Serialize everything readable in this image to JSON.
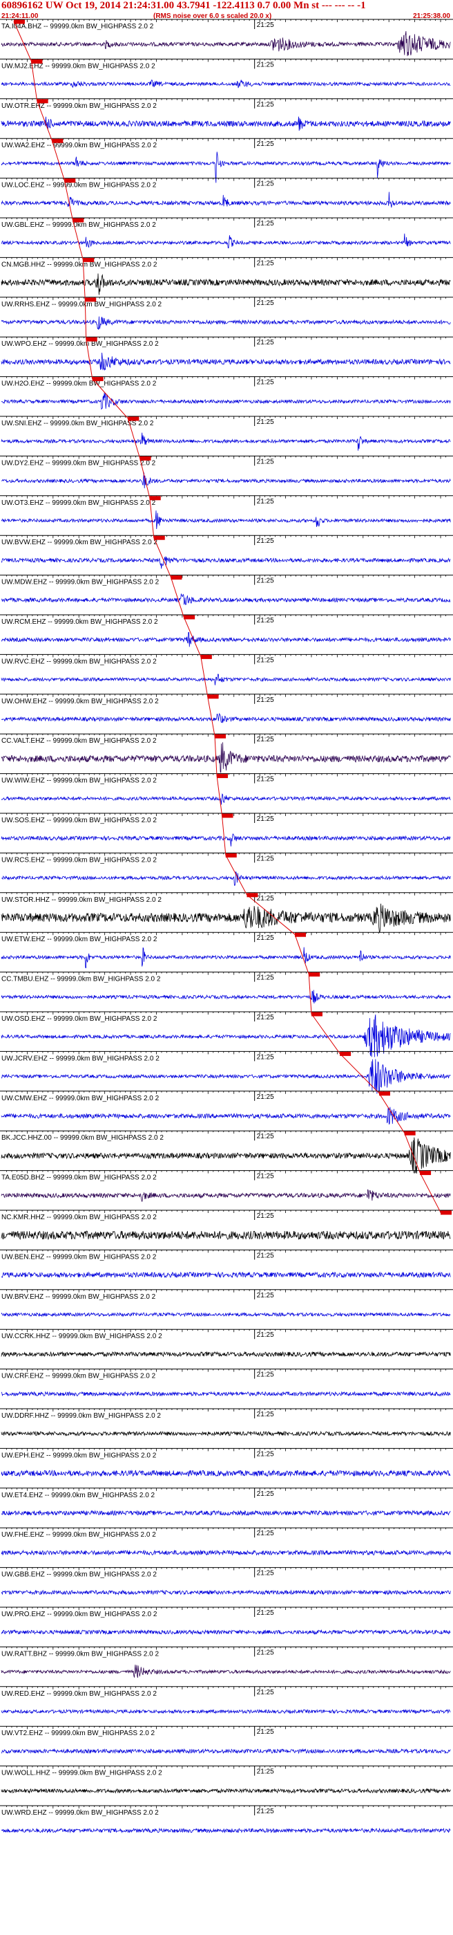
{
  "header": {
    "title": "60896162 UW Oct 19, 2014 21:24:31.00   43.7941 -122.4113  0.7 0.00 Mn st --- --- --  -1",
    "start_time": "21:24:11.00",
    "note": "(RMS noise over 6.0 s scaled 20.0 x)",
    "end_time": "21:25:38.00"
  },
  "chart_data": {
    "type": "line",
    "x_start": "21:24:11.00",
    "x_end": "21:25:38.00",
    "tick_label": "21:25",
    "colors": {
      "title": "#cc0000",
      "blue": "#0000dd",
      "black": "#000000",
      "purple": "#2a0050",
      "pick": "#dd0000"
    },
    "series": [
      {
        "name": "TA.I04A.BHZ -- 99999.0km BW_HIGHPASS  2.0  2",
        "color": "purple",
        "amp": 0.35,
        "bursts": [
          [
            20.1,
            1.6,
            0.55
          ],
          [
            53.0,
            6.0,
            1.4
          ],
          [
            78.0,
            9.0,
            2.4
          ]
        ],
        "pick": 2.4
      },
      {
        "name": "UW.MJ2.EHZ -- 99999.0km BW_HIGHPASS  2.0  2",
        "color": "blue",
        "amp": 0.3,
        "bursts": [
          [
            14,
            2,
            0.6
          ],
          [
            29,
            2,
            0.5
          ],
          [
            46,
            3,
            0.6
          ]
        ],
        "pick": 5.8
      },
      {
        "name": "UW.OTR.EHZ -- 99999.0km BW_HIGHPASS  2.0  2",
        "color": "blue",
        "amp": 0.5,
        "bursts": [
          [
            8.5,
            1.2,
            1.6
          ],
          [
            57.5,
            1.2,
            1.3
          ]
        ],
        "pick": 6.9
      },
      {
        "name": "UW.WA2.EHZ -- 99999.0km BW_HIGHPASS  2.0  2",
        "color": "blue",
        "amp": 0.3,
        "bursts": [
          [
            41.5,
            0.7,
            4.0
          ],
          [
            72.8,
            0.7,
            4.0
          ],
          [
            14.5,
            1.0,
            1.3
          ]
        ],
        "pick": 9.8
      },
      {
        "name": "UW.LOC.EHZ -- 99999.0km BW_HIGHPASS  2.0  2",
        "color": "blue",
        "amp": 0.35,
        "bursts": [
          [
            13,
            1.2,
            1.6
          ],
          [
            43,
            0.8,
            2.0
          ],
          [
            75,
            0.8,
            1.8
          ]
        ],
        "pick": 12.2
      },
      {
        "name": "UW.GBL.EHZ -- 99999.0km BW_HIGHPASS  2.0  2",
        "color": "blue",
        "amp": 0.3,
        "bursts": [
          [
            16.5,
            1.0,
            1.5
          ],
          [
            44,
            0.9,
            1.6
          ],
          [
            78,
            0.9,
            1.6
          ]
        ],
        "pick": 13.8
      },
      {
        "name": "CN.MGB.HHZ -- 99999.0km BW_HIGHPASS  2.0  2",
        "color": "black",
        "amp": 0.55,
        "bursts": [
          [
            18.5,
            1.5,
            3.0
          ]
        ],
        "pick": 15.8
      },
      {
        "name": "UW.RRHS.EHZ -- 99999.0km BW_HIGHPASS  2.0  2",
        "color": "blue",
        "amp": 0.35,
        "bursts": [
          [
            18.7,
            2.0,
            1.4
          ]
        ],
        "pick": 16.2
      },
      {
        "name": "UW.WPO.EHZ -- 99999.0km BW_HIGHPASS  2.0  2",
        "color": "blue",
        "amp": 0.45,
        "bursts": [
          [
            19.5,
            4.0,
            1.5
          ]
        ],
        "pick": 16.4
      },
      {
        "name": "UW.H2O.EHZ -- 99999.0km BW_HIGHPASS  2.0  2",
        "color": "blue",
        "amp": 0.3,
        "bursts": [
          [
            19.6,
            2.5,
            1.9
          ]
        ],
        "pick": 17.6
      },
      {
        "name": "UW.SNI.EHZ -- 99999.0km BW_HIGHPASS  2.0  2",
        "color": "blue",
        "amp": 0.3,
        "bursts": [
          [
            27,
            1.0,
            2.3
          ],
          [
            69,
            0.8,
            2.4
          ],
          [
            87,
            0.6,
            3.0
          ]
        ],
        "pick": 24.5
      },
      {
        "name": "UW.DY2.EHZ -- 99999.0km BW_HIGHPASS  2.0  2",
        "color": "blue",
        "amp": 0.3,
        "bursts": [
          [
            27.5,
            1.5,
            1.5
          ]
        ],
        "pick": 26.8
      },
      {
        "name": "UW.OT3.EHZ -- 99999.0km BW_HIGHPASS  2.0  2",
        "color": "blue",
        "amp": 0.3,
        "bursts": [
          [
            30,
            1.0,
            2.0
          ],
          [
            61,
            0.8,
            2.3
          ]
        ],
        "pick": 28.7
      },
      {
        "name": "UW.BVW.EHZ -- 99999.0km BW_HIGHPASS  2.0  2",
        "color": "blue",
        "amp": 0.35,
        "bursts": [
          [
            31,
            1.8,
            1.5
          ]
        ],
        "pick": 29.5
      },
      {
        "name": "UW.MDW.EHZ -- 99999.0km BW_HIGHPASS  2.0  2",
        "color": "blue",
        "amp": 0.35,
        "bursts": [
          [
            35,
            2.0,
            1.5
          ]
        ],
        "pick": 32.8
      },
      {
        "name": "UW.RCM.EHZ -- 99999.0km BW_HIGHPASS  2.0  2",
        "color": "blue",
        "amp": 0.35,
        "bursts": [
          [
            36,
            1.5,
            1.7
          ]
        ],
        "pick": 35.3
      },
      {
        "name": "UW.RVC.EHZ -- 99999.0km BW_HIGHPASS  2.0  2",
        "color": "blue",
        "amp": 0.3,
        "bursts": [
          [
            41.5,
            1.5,
            1.3
          ]
        ],
        "pick": 38.6
      },
      {
        "name": "UW.OHW.EHZ -- 99999.0km BW_HIGHPASS  2.0  2",
        "color": "blue",
        "amp": 0.35,
        "bursts": [
          [
            41.8,
            1.5,
            1.3
          ]
        ],
        "pick": 39.9
      },
      {
        "name": "CC.VALT.EHZ -- 99999.0km BW_HIGHPASS  2.0  2",
        "color": "purple",
        "amp": 0.6,
        "bursts": [
          [
            42.6,
            3.0,
            2.8
          ]
        ],
        "pick": 41.3
      },
      {
        "name": "UW.WIW.EHZ -- 99999.0km BW_HIGHPASS  2.0  2",
        "color": "blue",
        "amp": 0.3,
        "bursts": [
          [
            42.6,
            1.0,
            1.4
          ]
        ],
        "pick": 41.7
      },
      {
        "name": "UW.SOS.EHZ -- 99999.0km BW_HIGHPASS  2.0  2",
        "color": "blue",
        "amp": 0.35,
        "bursts": [
          [
            44.4,
            1.0,
            1.4
          ]
        ],
        "pick": 42.7
      },
      {
        "name": "UW.RCS.EHZ -- 99999.0km BW_HIGHPASS  2.0  2",
        "color": "blue",
        "amp": 0.3,
        "bursts": [
          [
            45.2,
            1.0,
            1.6
          ]
        ],
        "pick": 43.4
      },
      {
        "name": "UW.STOR.HHZ -- 99999.0km BW_HIGHPASS  2.0  2",
        "color": "black",
        "amp": 0.8,
        "bursts": [
          [
            48,
            10,
            1.9
          ],
          [
            73,
            8,
            1.9
          ]
        ],
        "pick": 47.5
      },
      {
        "name": "UW.ETW.EHZ -- 99999.0km BW_HIGHPASS  2.0  2",
        "color": "blue",
        "amp": 0.3,
        "bursts": [
          [
            16.3,
            0.6,
            2.8
          ],
          [
            27.3,
            0.6,
            2.4
          ],
          [
            58.6,
            0.8,
            2.4
          ],
          [
            69.4,
            0.6,
            2.4
          ]
        ],
        "pick": 56.8
      },
      {
        "name": "CC.TMBU.EHZ -- 99999.0km BW_HIGHPASS  2.0  2",
        "color": "blue",
        "amp": 0.3,
        "bursts": [
          [
            60.2,
            1.2,
            1.6
          ]
        ],
        "pick": 59.5
      },
      {
        "name": "UW.OSD.EHZ -- 99999.0km BW_HIGHPASS  2.0  2",
        "color": "blue",
        "amp": 0.3,
        "bursts": [
          [
            72,
            12,
            4.0
          ]
        ],
        "pick": 60.0
      },
      {
        "name": "UW.JCRV.EHZ -- 99999.0km BW_HIGHPASS  2.0  2",
        "color": "blue",
        "amp": 0.3,
        "bursts": [
          [
            72,
            7,
            3.8
          ]
        ],
        "pick": 65.5
      },
      {
        "name": "UW.CMW.EHZ -- 99999.0km BW_HIGHPASS  2.0  2",
        "color": "blue",
        "amp": 0.4,
        "bursts": [
          [
            75,
            4,
            1.6
          ]
        ],
        "pick": 73.1
      },
      {
        "name": "BK.JCC.HHZ.00 -- 99999.0km BW_HIGHPASS  2.0  2",
        "color": "black",
        "amp": 0.5,
        "bursts": [
          [
            80,
            7,
            3.2
          ]
        ],
        "pick": 78.0
      },
      {
        "name": "TA.E05D.BHZ -- 99999.0km BW_HIGHPASS  2.0  2",
        "color": "purple",
        "amp": 0.4,
        "bursts": [
          [
            27,
            1.5,
            1.0
          ],
          [
            71,
            2.0,
            1.2
          ]
        ],
        "pick": 81.0
      },
      {
        "name": "NC.KMR.HHZ -- 99999.0km BW_HIGHPASS  2.0  2",
        "color": "black",
        "amp": 0.75,
        "bursts": [],
        "pick": 85.0
      },
      {
        "name": "UW.BEN.EHZ -- 99999.0km BW_HIGHPASS  2.0  2",
        "color": "blue",
        "amp": 0.45,
        "bursts": []
      },
      {
        "name": "UW.BRV.EHZ -- 99999.0km BW_HIGHPASS  2.0  2",
        "color": "blue",
        "amp": 0.3,
        "bursts": []
      },
      {
        "name": "UW.CCRK.HHZ -- 99999.0km BW_HIGHPASS  2.0  2",
        "color": "black",
        "amp": 0.4,
        "bursts": []
      },
      {
        "name": "UW.CRF.EHZ -- 99999.0km BW_HIGHPASS  2.0  2",
        "color": "blue",
        "amp": 0.35,
        "bursts": []
      },
      {
        "name": "UW.DDRF.HHZ -- 99999.0km BW_HIGHPASS  2.0  2",
        "color": "black",
        "amp": 0.35,
        "bursts": []
      },
      {
        "name": "UW.EPH.EHZ -- 99999.0km BW_HIGHPASS  2.0  2",
        "color": "blue",
        "amp": 0.5,
        "bursts": []
      },
      {
        "name": "UW.ET4.EHZ -- 99999.0km BW_HIGHPASS  2.0  2",
        "color": "blue",
        "amp": 0.4,
        "bursts": []
      },
      {
        "name": "UW.FHE.EHZ -- 99999.0km BW_HIGHPASS  2.0  2",
        "color": "blue",
        "amp": 0.4,
        "bursts": []
      },
      {
        "name": "UW.GBB.EHZ -- 99999.0km BW_HIGHPASS  2.0  2",
        "color": "blue",
        "amp": 0.35,
        "bursts": []
      },
      {
        "name": "UW.PRO.EHZ -- 99999.0km BW_HIGHPASS  2.0  2",
        "color": "blue",
        "amp": 0.35,
        "bursts": []
      },
      {
        "name": "UW.RATT.BHZ -- 99999.0km BW_HIGHPASS  2.0  2",
        "color": "purple",
        "amp": 0.3,
        "bursts": [
          [
            26,
            3,
            1.2
          ]
        ]
      },
      {
        "name": "UW.RED.EHZ -- 99999.0km BW_HIGHPASS  2.0  2",
        "color": "blue",
        "amp": 0.3,
        "bursts": []
      },
      {
        "name": "UW.VT2.EHZ -- 99999.0km BW_HIGHPASS  2.0  2",
        "color": "blue",
        "amp": 0.35,
        "bursts": []
      },
      {
        "name": "UW.WOLL.HHZ -- 99999.0km BW_HIGHPASS  2.0  2",
        "color": "black",
        "amp": 0.35,
        "bursts": []
      },
      {
        "name": "UW.WRD.EHZ -- 99999.0km BW_HIGHPASS  2.0  2",
        "color": "blue",
        "amp": 0.35,
        "bursts": []
      }
    ]
  }
}
